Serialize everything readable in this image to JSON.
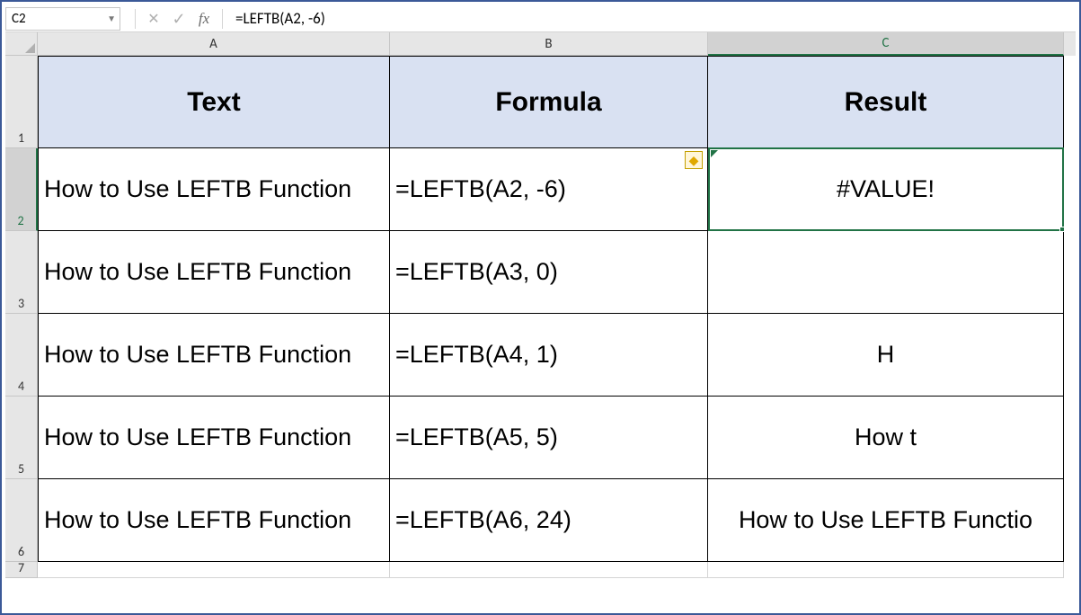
{
  "name_box": "C2",
  "formula_bar": "=LEFTB(A2, -6)",
  "columns": [
    "A",
    "B",
    "C"
  ],
  "row_nums": [
    "1",
    "2",
    "3",
    "4",
    "5",
    "6",
    "7"
  ],
  "headers": {
    "a": "Text",
    "b": "Formula",
    "c": "Result"
  },
  "rows": [
    {
      "text": "How to Use LEFTB Function",
      "formula": "=LEFTB(A2, -6)",
      "result": "#VALUE!"
    },
    {
      "text": "How to Use LEFTB Function",
      "formula": "=LEFTB(A3, 0)",
      "result": ""
    },
    {
      "text": "How to Use LEFTB Function",
      "formula": "=LEFTB(A4, 1)",
      "result": "H"
    },
    {
      "text": "How to Use LEFTB Function",
      "formula": "=LEFTB(A5, 5)",
      "result": "How t"
    },
    {
      "text": "How to Use LEFTB Function",
      "formula": "=LEFTB(A6, 24)",
      "result": "How to Use LEFTB Functio"
    }
  ],
  "fx_label": "fx"
}
